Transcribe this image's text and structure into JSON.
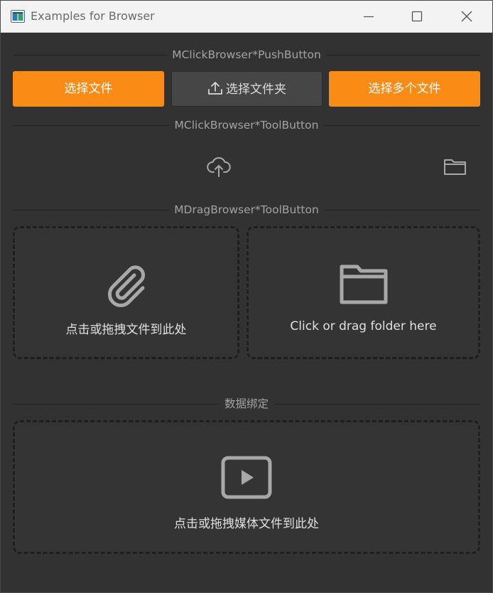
{
  "window": {
    "title": "Examples for Browser",
    "controls": {
      "minimize": "minimize-icon",
      "maximize": "maximize-icon",
      "close": "close-icon"
    }
  },
  "sections": {
    "push_button": "MClickBrowser*PushButton",
    "tool_button": "MClickBrowser*ToolButton",
    "drag_tool_button": "MDragBrowser*ToolButton",
    "data_binding": "数据绑定"
  },
  "push_buttons": {
    "select_file": "选择文件",
    "select_folder": "选择文件夹",
    "select_multiple_files": "选择多个文件"
  },
  "tool_buttons": {
    "upload_icon": "cloud-upload-icon",
    "folder_icon": "folder-icon"
  },
  "drag_zones": {
    "file_text": "点击或拖拽文件到此处",
    "folder_text": "Click or drag folder here",
    "media_text": "点击或拖拽媒体文件到此处"
  },
  "colors": {
    "accent": "#fa8c16",
    "background": "#323232",
    "icon": "#a8a8a8"
  }
}
